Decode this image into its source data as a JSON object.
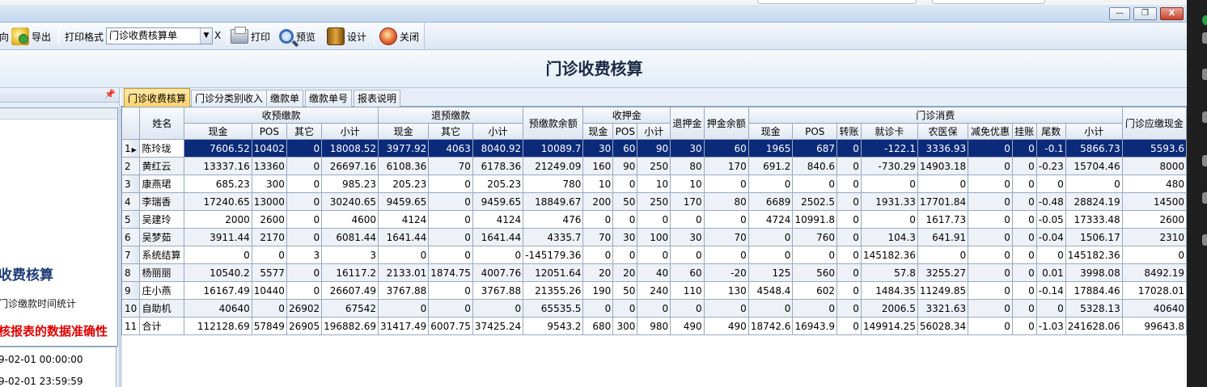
{
  "window": {
    "minimize": "—",
    "restore": "❐",
    "close": "X"
  },
  "toolbar": {
    "partial_label": "向",
    "export_label": "导出",
    "print_format_label": "打印格式",
    "print_format_value": "门诊收费核算单",
    "clear_label": "X",
    "print_label": "打印",
    "preview_label": "预览",
    "design_label": "设计",
    "close_label": "关闭",
    "icons": [
      "export-icon",
      "print-icon",
      "preview-icon",
      "design-icon",
      "close-icon"
    ]
  },
  "report_title": "门诊收费核算",
  "left_panel": {
    "pin": "📌",
    "heading": "收费核算",
    "note": "门诊缴款时间统计",
    "warning": "核报表的数据准确性",
    "date_start": "9-02-01 00:00:00",
    "date_end": "9-02-01 23:59:59"
  },
  "tabs": [
    "门诊收费核算",
    "门诊分类别收入",
    "缴款单",
    "缴款单号",
    "报表说明"
  ],
  "grid": {
    "group_headers": {
      "name": "姓名",
      "prepay": "收预缴款",
      "refund": "退预缴款",
      "prepay_balance": "预缴款余额",
      "deposit": "收押金",
      "refund_deposit": "退押金",
      "deposit_balance": "押金余额",
      "outpatient": "门诊消费",
      "cash_due": "门诊应缴现金"
    },
    "sub_headers": {
      "prepay": [
        "现金",
        "POS",
        "其它",
        "小计"
      ],
      "refund": [
        "现金",
        "其它",
        "小计"
      ],
      "deposit": [
        "现金",
        "POS",
        "小计"
      ],
      "outpatient": [
        "现金",
        "POS",
        "转账",
        "就诊卡",
        "农医保",
        "减免优惠",
        "挂账",
        "尾数",
        "小计"
      ]
    },
    "rows": [
      [
        "1",
        "陈玲珑",
        "7606.52",
        "10402",
        "0",
        "18008.52",
        "3977.92",
        "4063",
        "8040.92",
        "10089.7",
        "30",
        "60",
        "90",
        "30",
        "60",
        "1965",
        "687",
        "0",
        "-122.1",
        "3336.93",
        "0",
        "0",
        "-0.1",
        "5866.73",
        "5593.6"
      ],
      [
        "2",
        "黄红云",
        "13337.16",
        "13360",
        "0",
        "26697.16",
        "6108.36",
        "70",
        "6178.36",
        "21249.09",
        "160",
        "90",
        "250",
        "80",
        "170",
        "691.2",
        "840.6",
        "0",
        "-730.29",
        "14903.18",
        "0",
        "0",
        "-0.23",
        "15704.46",
        "8000"
      ],
      [
        "3",
        "康燕珺",
        "685.23",
        "300",
        "0",
        "985.23",
        "205.23",
        "0",
        "205.23",
        "780",
        "10",
        "0",
        "10",
        "10",
        "0",
        "0",
        "0",
        "0",
        "0",
        "0",
        "0",
        "0",
        "0",
        "0",
        "480"
      ],
      [
        "4",
        "李瑞香",
        "17240.65",
        "13000",
        "0",
        "30240.65",
        "9459.65",
        "0",
        "9459.65",
        "18849.67",
        "200",
        "50",
        "250",
        "170",
        "80",
        "6689",
        "2502.5",
        "0",
        "1931.33",
        "17701.84",
        "0",
        "0",
        "-0.48",
        "28824.19",
        "14500"
      ],
      [
        "5",
        "吴建玲",
        "2000",
        "2600",
        "0",
        "4600",
        "4124",
        "0",
        "4124",
        "476",
        "0",
        "0",
        "0",
        "0",
        "0",
        "4724",
        "10991.8",
        "0",
        "0",
        "1617.73",
        "0",
        "0",
        "-0.05",
        "17333.48",
        "2600"
      ],
      [
        "6",
        "吴梦茹",
        "3911.44",
        "2170",
        "0",
        "6081.44",
        "1641.44",
        "0",
        "1641.44",
        "4335.7",
        "70",
        "30",
        "100",
        "30",
        "70",
        "0",
        "760",
        "0",
        "104.3",
        "641.91",
        "0",
        "0",
        "-0.04",
        "1506.17",
        "2310"
      ],
      [
        "7",
        "系统结算",
        "0",
        "0",
        "3",
        "3",
        "0",
        "0",
        "0",
        "-145179.36",
        "0",
        "0",
        "0",
        "0",
        "0",
        "0",
        "0",
        "0",
        "145182.36",
        "0",
        "0",
        "0",
        "0",
        "145182.36",
        "0"
      ],
      [
        "8",
        "杨丽丽",
        "10540.2",
        "5577",
        "0",
        "16117.2",
        "2133.01",
        "1874.75",
        "4007.76",
        "12051.64",
        "20",
        "20",
        "40",
        "60",
        "-20",
        "125",
        "560",
        "0",
        "57.8",
        "3255.27",
        "0",
        "0",
        "0.01",
        "3998.08",
        "8492.19"
      ],
      [
        "9",
        "庄小燕",
        "16167.49",
        "10440",
        "0",
        "26607.49",
        "3767.88",
        "0",
        "3767.88",
        "21355.26",
        "190",
        "50",
        "240",
        "110",
        "130",
        "4548.4",
        "602",
        "0",
        "1484.35",
        "11249.85",
        "0",
        "0",
        "-0.14",
        "17884.46",
        "17028.01"
      ],
      [
        "10",
        "自助机",
        "40640",
        "0",
        "26902",
        "67542",
        "0",
        "0",
        "0",
        "65535.5",
        "0",
        "0",
        "0",
        "0",
        "0",
        "0",
        "0",
        "0",
        "2006.5",
        "3321.63",
        "0",
        "0",
        "0",
        "5328.13",
        "40640"
      ],
      [
        "11",
        "合计",
        "112128.69",
        "57849",
        "26905",
        "196882.69",
        "31417.49",
        "6007.75",
        "37425.24",
        "9543.2",
        "680",
        "300",
        "980",
        "490",
        "490",
        "18742.6",
        "16943.9",
        "0",
        "149914.25",
        "56028.34",
        "0",
        "0",
        "-1.03",
        "241628.06",
        "99643.8"
      ]
    ]
  }
}
